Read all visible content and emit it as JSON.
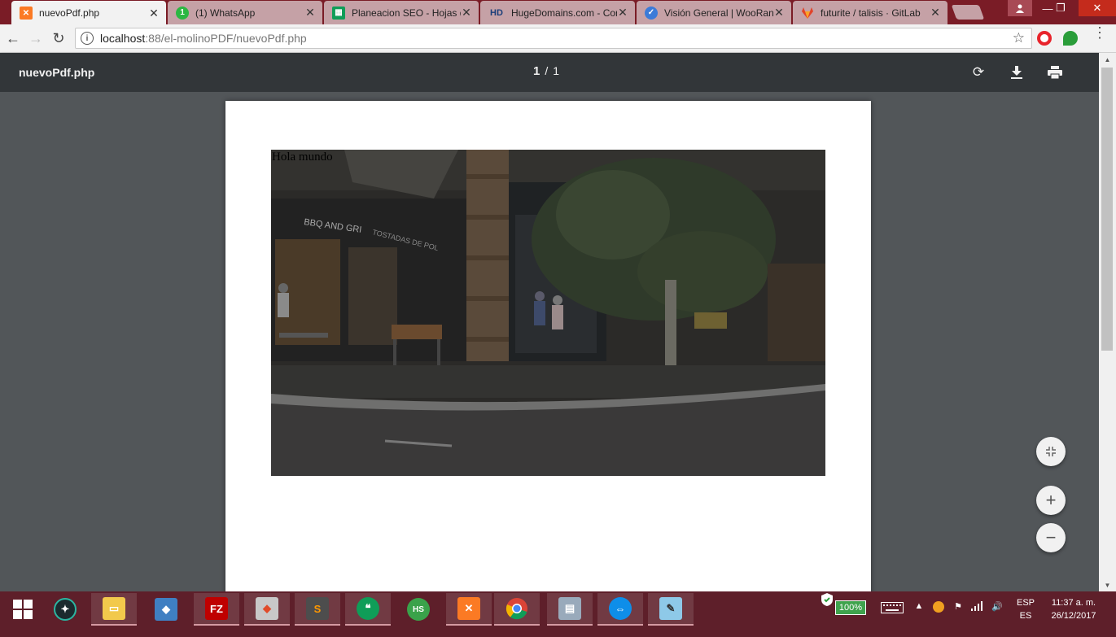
{
  "browser": {
    "tabs": [
      {
        "title": "nuevoPdf.php",
        "favicon": "xampp-icon",
        "color": "#fb7a24",
        "active": true
      },
      {
        "title": "(1) WhatsApp",
        "favicon": "whatsapp-icon",
        "color": "#2cb742",
        "active": false
      },
      {
        "title": "Planeacion SEO - Hojas d",
        "favicon": "sheets-icon",
        "color": "#0f9d58",
        "active": false
      },
      {
        "title": "HugeDomains.com - Cor",
        "favicon": "hugedomains-icon",
        "color": "#1a3e7a",
        "active": false
      },
      {
        "title": "Visión General | WooRan",
        "favicon": "woorank-icon",
        "color": "#3b7bd8",
        "active": false
      },
      {
        "title": "futurite / talisis · GitLab",
        "favicon": "gitlab-icon",
        "color": "#e24329",
        "active": false
      }
    ],
    "tab_close": "✕",
    "address": {
      "host": "localhost",
      "path": ":88/el-molinoPDF/nuevoPdf.php"
    }
  },
  "pdf_viewer": {
    "title": "nuevoPdf.php",
    "current_page": "1",
    "separator": "/",
    "total_pages": "1",
    "page_text": "Hola mundo"
  },
  "taskbar": {
    "tray_battery": "100%",
    "language_top": "ESP",
    "language_bottom": "ES",
    "time": "11:37 a. m.",
    "date": "26/12/2017"
  },
  "colors": {
    "tabstrip": "#7a1c26",
    "pdf_toolbar": "#323639",
    "pdf_background": "#525659",
    "taskbar": "#5e1f2a"
  }
}
